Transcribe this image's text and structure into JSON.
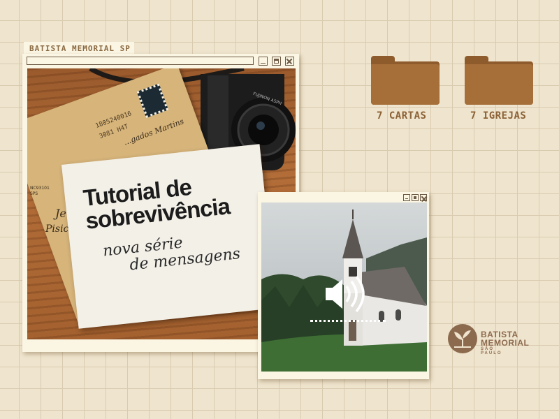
{
  "window_main": {
    "title": "BATISTA MEMORIAL SP"
  },
  "photo_main": {
    "envelope_text_line1": "1805240016",
    "envelope_text_line2": "3081 H4T",
    "envelope_text_signature": "...gados Martins",
    "envelope_side_code": "NC93101",
    "envelope_side_code2": "SPS",
    "envelope_side_letters": "Je",
    "envelope_side_letters2": "Pisic",
    "camera_lens_text": "FUJINON ASPH",
    "card": {
      "title_line1": "Tutorial de",
      "title_line2": "sobrevivência",
      "script_line1": "nova série",
      "script_line2": "de mensagens"
    }
  },
  "desktop": {
    "folders": [
      {
        "label": "7 CARTAS",
        "icon": "folder-icon"
      },
      {
        "label": "7 IGREJAS",
        "icon": "folder-icon"
      }
    ]
  },
  "logo": {
    "line1": "BATISTA",
    "line2": "MEMORIAL",
    "line3": "SÃO PAULO"
  },
  "colors": {
    "background": "#efe4cd",
    "grid": "#d9cbb0",
    "folder": "#a66f3a",
    "folder_label": "#8c6237",
    "window_frame": "#fbf5e3",
    "logo": "#8c6a4e"
  }
}
